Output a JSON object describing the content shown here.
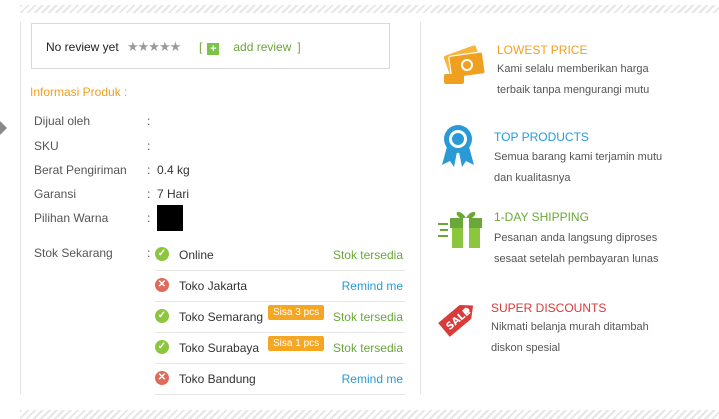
{
  "review": {
    "no_review": "No review yet",
    "stars": "★★★★★",
    "bracket_open": "[",
    "add_review": "add review",
    "bracket_close": "]"
  },
  "info": {
    "title": "Informasi Produk :",
    "rows": [
      {
        "label": "Dijual oleh",
        "value": ""
      },
      {
        "label": "SKU",
        "value": ""
      },
      {
        "label": "Berat Pengiriman",
        "value": "0.4 kg"
      },
      {
        "label": "Garansi",
        "value": "7 Hari"
      },
      {
        "label": "Pilihan Warna",
        "value": ""
      },
      {
        "label": "Stok Sekarang",
        "value": ""
      }
    ],
    "colon": ":",
    "swatch_color": "#000000"
  },
  "stock": [
    {
      "store": "Online",
      "available": true,
      "badge": "",
      "status": "Stok tersedia"
    },
    {
      "store": "Toko Jakarta",
      "available": false,
      "badge": "",
      "status": "Remind me"
    },
    {
      "store": "Toko Semarang",
      "available": true,
      "badge": "Sisa 3 pcs",
      "status": "Stok tersedia"
    },
    {
      "store": "Toko Surabaya",
      "available": true,
      "badge": "Sisa 1 pcs",
      "status": "Stok tersedia"
    },
    {
      "store": "Toko Bandung",
      "available": false,
      "badge": "",
      "status": "Remind me"
    }
  ],
  "features": [
    {
      "icon": "money-icon",
      "title": "LOWEST PRICE",
      "color": "#f0a020",
      "desc1": "Kami selalu memberikan harga",
      "desc2": "terbaik tanpa mengurangi mutu"
    },
    {
      "icon": "ribbon-award-icon",
      "title": "TOP PRODUCTS",
      "color": "#2a9ad6",
      "desc1": "Semua barang kami terjamin mutu",
      "desc2": "dan kualitasnya"
    },
    {
      "icon": "gift-shipping-icon",
      "title": "1-DAY SHIPPING",
      "color": "#6aa83a",
      "desc1": "Pesanan anda langsung diproses",
      "desc2": "sesaat setelah pembayaran lunas"
    },
    {
      "icon": "sale-tag-icon",
      "title": "SUPER DISCOUNTS",
      "color": "#d93a3a",
      "desc1": "Nikmati belanja murah ditambah",
      "desc2": "diskon spesial"
    }
  ],
  "colors": {
    "ok": "#8cc63f",
    "no": "#e06a5a",
    "badge": "#f5a623"
  }
}
